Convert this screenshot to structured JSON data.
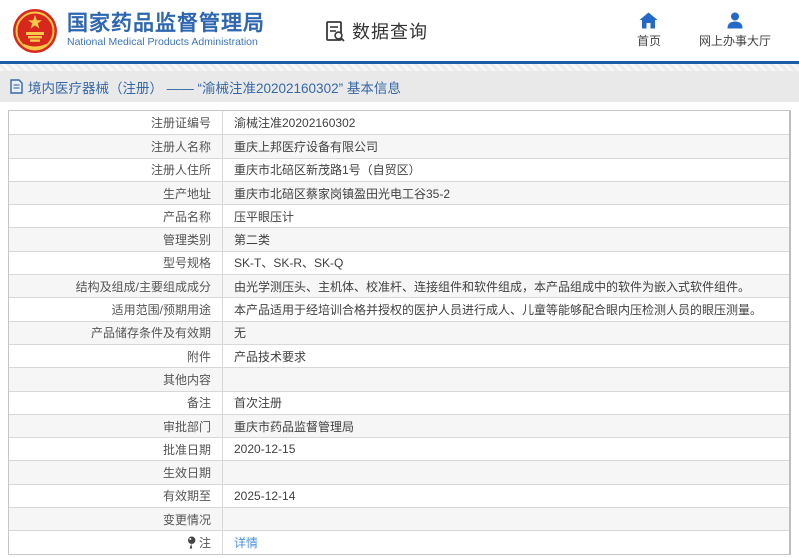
{
  "header": {
    "org_name_cn": "国家药品监督管理局",
    "org_name_en": "National Medical Products Administration",
    "section_title": "数据查询",
    "nav": [
      {
        "label": "首页",
        "icon": "home-icon"
      },
      {
        "label": "网上办事大厅",
        "icon": "user-icon"
      }
    ]
  },
  "breadcrumb": {
    "text": "境内医疗器械（注册） ——  “渝械注准20202160302”  基本信息",
    "icon": "document-icon"
  },
  "table": {
    "rows": [
      {
        "label": "注册证编号",
        "value": "渝械注准20202160302"
      },
      {
        "label": "注册人名称",
        "value": "重庆上邦医疗设备有限公司"
      },
      {
        "label": "注册人住所",
        "value": "重庆市北碚区新茂路1号（自贸区）"
      },
      {
        "label": "生产地址",
        "value": "重庆市北碚区蔡家岗镇盈田光电工谷35-2"
      },
      {
        "label": "产品名称",
        "value": "压平眼压计"
      },
      {
        "label": "管理类别",
        "value": "第二类"
      },
      {
        "label": "型号规格",
        "value": "SK-T、SK-R、SK-Q"
      },
      {
        "label": "结构及组成/主要组成成分",
        "value": "由光学测压头、主机体、校准杆、连接组件和软件组成，本产品组成中的软件为嵌入式软件组件。"
      },
      {
        "label": "适用范围/预期用途",
        "value": "本产品适用于经培训合格并授权的医护人员进行成人、儿童等能够配合眼内压检测人员的眼压测量。"
      },
      {
        "label": "产品储存条件及有效期",
        "value": "无"
      },
      {
        "label": "附件",
        "value": "产品技术要求"
      },
      {
        "label": "其他内容",
        "value": ""
      },
      {
        "label": "备注",
        "value": "首次注册"
      },
      {
        "label": "审批部门",
        "value": "重庆市药品监督管理局"
      },
      {
        "label": "批准日期",
        "value": "2020-12-15"
      },
      {
        "label": "生效日期",
        "value": ""
      },
      {
        "label": "有效期至",
        "value": "2025-12-14"
      },
      {
        "label": "变更情况",
        "value": ""
      },
      {
        "label": "注",
        "value": "详情",
        "link": true,
        "icon": "note-pin-icon"
      }
    ]
  },
  "colors": {
    "accent_blue": "#2e66b0",
    "nav_icon_blue": "#2468c8",
    "top_bar_blue": "#1e5ca8",
    "link_blue": "#4a90e2",
    "emblem_red": "#d8281e",
    "emblem_gold": "#f7c948",
    "strip_gray": "#e9e9e9"
  }
}
